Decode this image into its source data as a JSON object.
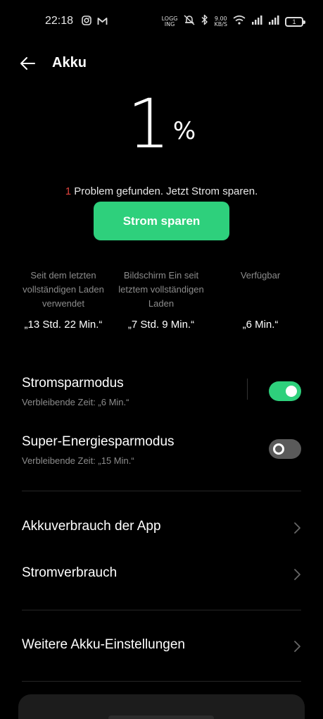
{
  "status_bar": {
    "time": "22:18",
    "left_icons": [
      "instagram-icon",
      "gmail-icon"
    ],
    "right_icons": [
      "volte-icon",
      "mute-icon",
      "bluetooth-icon",
      "net-speed-icon",
      "wifi-icon",
      "signal-1-icon",
      "signal-2-icon",
      "battery-icon"
    ],
    "volte_line1": "LOGG",
    "volte_line2": "ING",
    "net_speed_value": "9.00",
    "net_speed_unit": "KB/S",
    "battery_level": "1"
  },
  "header": {
    "back_icon": "back-arrow-icon",
    "title": "Akku"
  },
  "battery": {
    "percent": "1",
    "percent_sign": "%",
    "problem_count": "1",
    "problem_text": " Problem gefunden. Jetzt Strom sparen.",
    "save_button_label": "Strom sparen"
  },
  "stats": [
    {
      "label": "Seit dem letzten vollständigen Laden verwendet",
      "value": "„13 Std. 22 Min.“"
    },
    {
      "label": "Bildschirm Ein seit letztem vollständigen Laden",
      "value": "„7 Std. 9 Min.“"
    },
    {
      "label": "Verfügbar",
      "value": "„6 Min.“"
    }
  ],
  "modes": [
    {
      "title": "Stromsparmodus",
      "subtitle": "Verbleibende Zeit:  „6 Min.“",
      "enabled": true
    },
    {
      "title": "Super-Energiesparmodus",
      "subtitle": "Verbleibende Zeit:  „15 Min.“",
      "enabled": false
    }
  ],
  "nav": [
    {
      "label": "Akkuverbrauch der App"
    },
    {
      "label": "Stromverbrauch"
    },
    {
      "label": "Weitere Akku-Einstellungen"
    }
  ],
  "colors": {
    "accent": "#2ed07c",
    "problem": "#e0443e",
    "background": "#000000",
    "muted_text": "#8c8c8c"
  }
}
